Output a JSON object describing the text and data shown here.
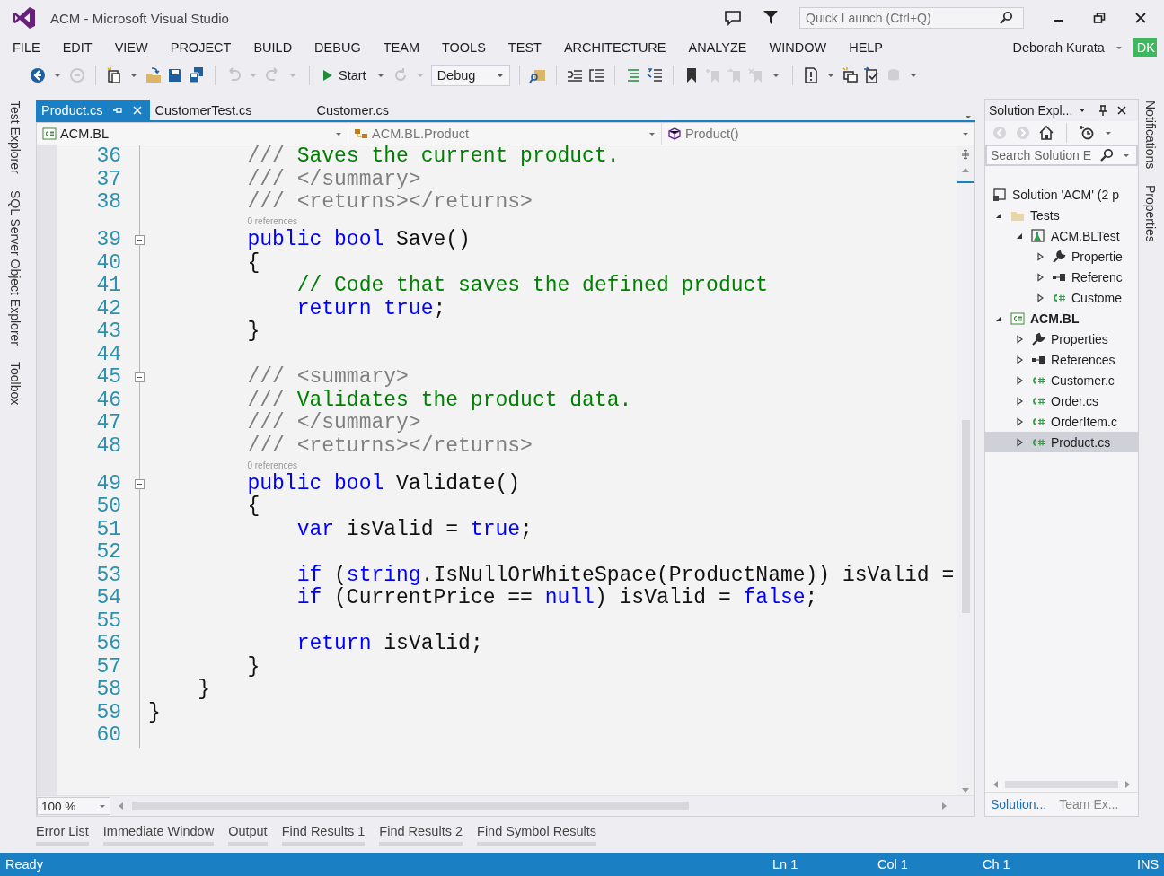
{
  "window": {
    "title": "ACM - Microsoft Visual Studio",
    "quick_launch": {
      "placeholder": "Quick Launch (Ctrl+Q)"
    }
  },
  "menu": {
    "items": [
      "FILE",
      "EDIT",
      "VIEW",
      "PROJECT",
      "BUILD",
      "DEBUG",
      "TEAM",
      "TOOLS",
      "TEST",
      "ARCHITECTURE",
      "ANALYZE",
      "WINDOW",
      "HELP"
    ],
    "user": "Deborah Kurata",
    "avatar": "DK"
  },
  "toolbar": {
    "start": "Start",
    "configuration": "Debug"
  },
  "left_strip": [
    "Test Explorer",
    "SQL Server Object Explorer",
    "Toolbox"
  ],
  "right_strip": [
    "Notifications",
    "Properties"
  ],
  "tabs": [
    {
      "label": "Product.cs",
      "selected": true
    },
    {
      "label": "CustomerTest.cs",
      "selected": false
    },
    {
      "label": "Customer.cs",
      "selected": false
    }
  ],
  "navigation": [
    {
      "kind": "project",
      "label": "ACM.BL"
    },
    {
      "kind": "class",
      "label": "ACM.BL.Product"
    },
    {
      "kind": "method",
      "label": "Product()"
    }
  ],
  "editor": {
    "rows": [
      {
        "kind": "code",
        "number": "36",
        "fold": false,
        "indent": "        ",
        "tokens": [
          {
            "kind": "doc",
            "t": "/// "
          },
          {
            "kind": "cmt",
            "t": "Saves the current product."
          }
        ]
      },
      {
        "kind": "code",
        "number": "37",
        "fold": false,
        "indent": "        ",
        "tokens": [
          {
            "kind": "doc",
            "t": "/// </summary>"
          }
        ]
      },
      {
        "kind": "code",
        "number": "38",
        "fold": false,
        "indent": "        ",
        "tokens": [
          {
            "kind": "doc",
            "t": "/// <returns></returns>"
          }
        ]
      },
      {
        "kind": "lens",
        "indent": "        ",
        "text": "0 references"
      },
      {
        "kind": "code",
        "number": "39",
        "fold": true,
        "indent": "        ",
        "tokens": [
          {
            "kind": "kw",
            "t": "public bool"
          },
          {
            "kind": "plain",
            "t": " Save()"
          }
        ]
      },
      {
        "kind": "code",
        "number": "40",
        "fold": false,
        "indent": "        ",
        "tokens": [
          {
            "kind": "plain",
            "t": "{"
          }
        ]
      },
      {
        "kind": "code",
        "number": "41",
        "fold": false,
        "indent": "            ",
        "tokens": [
          {
            "kind": "cmt",
            "t": "// Code that saves the defined product"
          }
        ]
      },
      {
        "kind": "code",
        "number": "42",
        "fold": false,
        "indent": "            ",
        "tokens": [
          {
            "kind": "kw",
            "t": "return true"
          },
          {
            "kind": "plain",
            "t": ";"
          }
        ]
      },
      {
        "kind": "code",
        "number": "43",
        "fold": false,
        "indent": "        ",
        "tokens": [
          {
            "kind": "plain",
            "t": "}"
          }
        ]
      },
      {
        "kind": "code",
        "number": "44",
        "fold": false
      },
      {
        "kind": "code",
        "number": "45",
        "fold": true,
        "indent": "        ",
        "tokens": [
          {
            "kind": "doc",
            "t": "/// <summary>"
          }
        ]
      },
      {
        "kind": "code",
        "number": "46",
        "fold": false,
        "indent": "        ",
        "tokens": [
          {
            "kind": "doc",
            "t": "/// "
          },
          {
            "kind": "cmt",
            "t": "Validates the product data."
          }
        ]
      },
      {
        "kind": "code",
        "number": "47",
        "fold": false,
        "indent": "        ",
        "tokens": [
          {
            "kind": "doc",
            "t": "/// </summary>"
          }
        ]
      },
      {
        "kind": "code",
        "number": "48",
        "fold": false,
        "indent": "        ",
        "tokens": [
          {
            "kind": "doc",
            "t": "/// <returns></returns>"
          }
        ]
      },
      {
        "kind": "lens",
        "indent": "        ",
        "text": "0 references"
      },
      {
        "kind": "code",
        "number": "49",
        "fold": true,
        "indent": "        ",
        "tokens": [
          {
            "kind": "kw",
            "t": "public bool"
          },
          {
            "kind": "plain",
            "t": " Validate()"
          }
        ]
      },
      {
        "kind": "code",
        "number": "50",
        "fold": false,
        "indent": "        ",
        "tokens": [
          {
            "kind": "plain",
            "t": "{"
          }
        ]
      },
      {
        "kind": "code",
        "number": "51",
        "fold": false,
        "indent": "            ",
        "tokens": [
          {
            "kind": "kw",
            "t": "var"
          },
          {
            "kind": "plain",
            "t": " isValid = "
          },
          {
            "kind": "kw",
            "t": "true"
          },
          {
            "kind": "plain",
            "t": ";"
          }
        ]
      },
      {
        "kind": "code",
        "number": "52",
        "fold": false
      },
      {
        "kind": "code",
        "number": "53",
        "fold": false,
        "indent": "            ",
        "tokens": [
          {
            "kind": "kw",
            "t": "if"
          },
          {
            "kind": "plain",
            "t": " ("
          },
          {
            "kind": "kw",
            "t": "string"
          },
          {
            "kind": "plain",
            "t": ".IsNullOrWhiteSpace(ProductName)) isValid ="
          }
        ]
      },
      {
        "kind": "code",
        "number": "54",
        "fold": false,
        "indent": "            ",
        "tokens": [
          {
            "kind": "kw",
            "t": "if"
          },
          {
            "kind": "plain",
            "t": " (CurrentPrice == "
          },
          {
            "kind": "kw",
            "t": "null"
          },
          {
            "kind": "plain",
            "t": ") isValid = "
          },
          {
            "kind": "kw",
            "t": "false"
          },
          {
            "kind": "plain",
            "t": ";"
          }
        ]
      },
      {
        "kind": "code",
        "number": "55",
        "fold": false
      },
      {
        "kind": "code",
        "number": "56",
        "fold": false,
        "indent": "            ",
        "tokens": [
          {
            "kind": "kw",
            "t": "return"
          },
          {
            "kind": "plain",
            "t": " isValid;"
          }
        ]
      },
      {
        "kind": "code",
        "number": "57",
        "fold": false,
        "indent": "        ",
        "tokens": [
          {
            "kind": "plain",
            "t": "}"
          }
        ]
      },
      {
        "kind": "code",
        "number": "58",
        "fold": false,
        "indent": "    ",
        "tokens": [
          {
            "kind": "plain",
            "t": "}"
          }
        ]
      },
      {
        "kind": "code",
        "number": "59",
        "fold": false,
        "tokens": [
          {
            "kind": "plain",
            "t": "}"
          }
        ]
      },
      {
        "kind": "code",
        "number": "60",
        "fold": false
      }
    ],
    "zoom": "100 %"
  },
  "bottom_tabs": [
    "Error List",
    "Immediate Window",
    "Output",
    "Find Results 1",
    "Find Results 2",
    "Find Symbol Results"
  ],
  "solution_explorer": {
    "title": "Solution Expl...",
    "search": {
      "placeholder": "Search Solution E"
    },
    "tree": [
      {
        "kind": "solution",
        "label": "Solution 'ACM' (2 p",
        "selected": false,
        "children": [
          {
            "kind": "folder",
            "label": "Tests",
            "expanded": true,
            "selected": false,
            "children": [
              {
                "kind": "testproject",
                "label": "ACM.BLTest",
                "expanded": true,
                "selected": false,
                "children": [
                  {
                    "kind": "wrench",
                    "label": "Propertie",
                    "expanded": false,
                    "selected": false
                  },
                  {
                    "kind": "references",
                    "label": "Referenc",
                    "expanded": false,
                    "selected": false
                  },
                  {
                    "kind": "csharp",
                    "label": "Custome",
                    "expanded": false,
                    "selected": false
                  }
                ]
              }
            ]
          },
          {
            "kind": "project",
            "label": "ACM.BL",
            "expanded": true,
            "selected": false,
            "children": [
              {
                "kind": "wrench",
                "label": "Properties",
                "expanded": false,
                "selected": false
              },
              {
                "kind": "references",
                "label": "References",
                "expanded": false,
                "selected": false
              },
              {
                "kind": "csharp",
                "label": "Customer.c",
                "expanded": false,
                "selected": false
              },
              {
                "kind": "csharp",
                "label": "Order.cs",
                "expanded": false,
                "selected": false
              },
              {
                "kind": "csharp",
                "label": "OrderItem.c",
                "expanded": false,
                "selected": false
              },
              {
                "kind": "csharp",
                "label": "Product.cs",
                "expanded": false,
                "selected": true
              }
            ]
          }
        ]
      }
    ],
    "tabs": [
      {
        "label": "Solution...",
        "selected": true
      },
      {
        "label": "Team Ex...",
        "selected": false
      }
    ]
  },
  "status_bar": {
    "message": "Ready",
    "line": "Ln 1",
    "column": "Col 1",
    "character": "Ch 1",
    "mode": "INS"
  }
}
